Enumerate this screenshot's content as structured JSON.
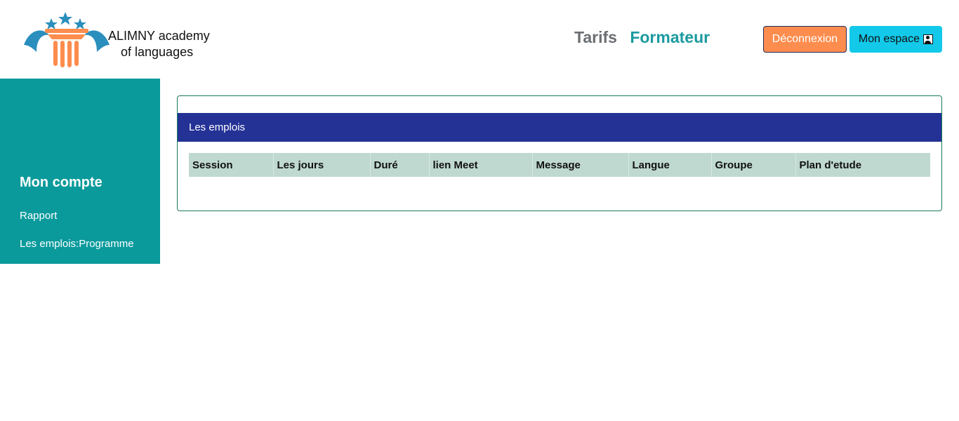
{
  "brand": {
    "line1": "ALIMNY academy",
    "line2": "of languages"
  },
  "nav": {
    "tarifs": "Tarifs",
    "formateur": "Formateur"
  },
  "buttons": {
    "logout": "Déconnexion",
    "space": "Mon espace"
  },
  "sidebar": {
    "title": "Mon compte",
    "items": [
      {
        "label": "Rapport"
      },
      {
        "label": "Les emplois:Programme"
      }
    ]
  },
  "card": {
    "title": "Les emplois",
    "columns": [
      "Session",
      "Les jours",
      "Duré",
      "lien Meet",
      "Message",
      "Langue",
      "Groupe",
      "Plan d'etude"
    ]
  },
  "colors": {
    "brand_teal": "#0b9a9c",
    "header_blue": "#243296",
    "logout_orange": "#fd8d4e",
    "space_cyan": "#12c9ea",
    "table_header": "#bfd9d1"
  },
  "icons": {
    "logo": "academy-pillar-logo",
    "user": "user-portrait-icon"
  }
}
